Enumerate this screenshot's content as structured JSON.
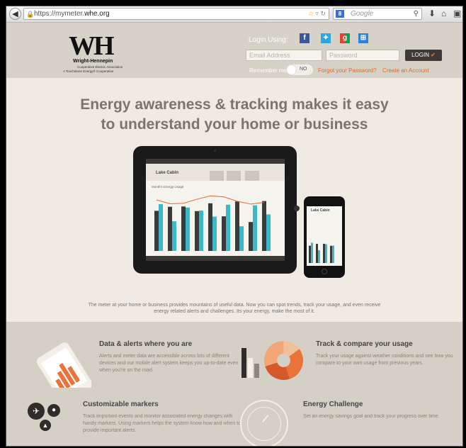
{
  "browser": {
    "url_scheme": "https://",
    "url_subdomain": "mymeter.",
    "url_host": "whe.org",
    "search_placeholder": "Google",
    "search_engine_letter": "8"
  },
  "header": {
    "logo_mark": "WH",
    "logo_name": "Wright-Hennepin",
    "logo_sub": "Cooperative Electric Association",
    "logo_tag": "A Touchstone Energy® Cooperative",
    "login_label": "Login Using:",
    "email_placeholder": "Email Address",
    "password_placeholder": "Password",
    "login_button": "LOGIN",
    "remember_label": "Remember me",
    "toggle_state": "NO",
    "forgot_link": "Forgot your Password?",
    "create_link": "Create an Account"
  },
  "hero": {
    "title_line1": "Energy awareness & tracking makes it easy",
    "title_line2": "to understand your home or business",
    "tablet_title": "Lake Cabin",
    "phone_title": "Lake Cabin",
    "chart_label": "Month's Energy Usage",
    "description": "The meter at your home or business provides mountains of useful data. Now you can spot trends, track your usage, and even receive energy related alerts and challenges. Its your energy, make the most of it."
  },
  "features": [
    {
      "title": "Data & alerts where you are",
      "text": "Alerts and meter data are accessible across lots of different devices and our mobile alert system keeps you up-to-date even when you're on the road."
    },
    {
      "title": "Track & compare your usage",
      "text": "Track your usage against weather conditions and see how you compare to your own usage from previous years."
    },
    {
      "title": "Customizable markers",
      "text": "Track important events and monitor associated energy changes with handy markers. Using markers helps the system know how and when to provide important alerts."
    },
    {
      "title": "Energy Challenge",
      "text": "Set an energy savings goal and track your progress over time."
    }
  ],
  "colors": {
    "accent": "#e5672b",
    "title_gray": "#7b756a",
    "bar_teal": "#3bb8c9",
    "bar_dark": "#3a3a3a"
  },
  "icons": [
    "back-arrow-icon",
    "lock-icon",
    "star-icon",
    "refresh-icon",
    "search-icon",
    "download-icon",
    "home-icon",
    "menu-icon",
    "facebook-icon",
    "twitter-icon",
    "google-icon",
    "windows-icon",
    "check-icon",
    "phone-chart-icon",
    "bar-chart-icon",
    "pie-chart-icon",
    "airplane-marker-icon",
    "lightbulb-marker-icon",
    "cake-marker-icon",
    "gauge-icon"
  ]
}
